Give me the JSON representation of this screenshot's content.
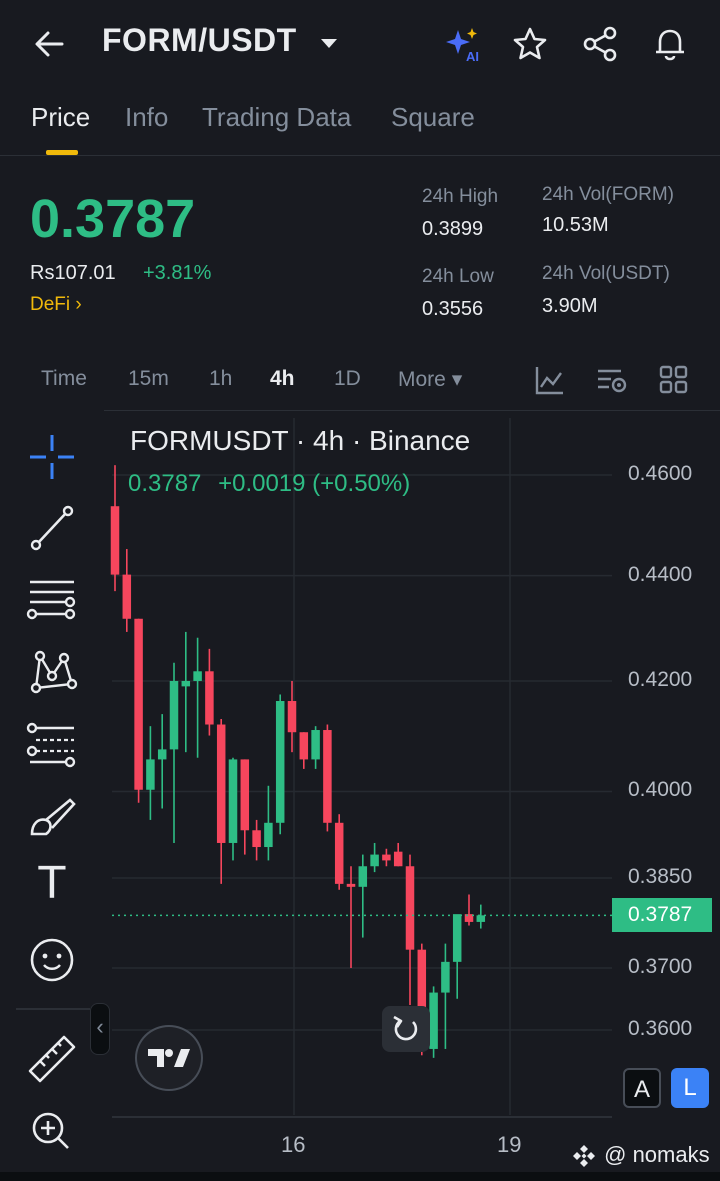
{
  "header": {
    "pair": "FORM/USDT",
    "icons": [
      "back-arrow-icon",
      "caret-down-icon",
      "ai-sparkle-icon",
      "star-icon",
      "share-icon",
      "bell-icon"
    ]
  },
  "tabs": [
    {
      "label": "Price",
      "active": true
    },
    {
      "label": "Info",
      "active": false
    },
    {
      "label": "Trading Data",
      "active": false
    },
    {
      "label": "Square",
      "active": false
    }
  ],
  "ticker": {
    "price": "0.3787",
    "fiat": "Rs107.01",
    "change": "+3.81%",
    "category": "DeFi",
    "category_chevron": "›",
    "high_label": "24h High",
    "high_value": "0.3899",
    "low_label": "24h Low",
    "low_value": "0.3556",
    "vol_base_label": "24h Vol(FORM)",
    "vol_base_value": "10.53M",
    "vol_quote_label": "24h Vol(USDT)",
    "vol_quote_value": "3.90M"
  },
  "intervals": {
    "items": [
      "Time",
      "15m",
      "1h",
      "4h",
      "1D"
    ],
    "active": "4h",
    "more_label": "More",
    "more_caret": "▾"
  },
  "colors": {
    "up": "#2ebd85",
    "down": "#f6465d",
    "accent": "#f0b90b",
    "background": "#181a20",
    "blue": "#3b82f6"
  },
  "chart": {
    "title": "FORMUSDT · 4h · Binance",
    "last": "0.3787",
    "delta": "+0.0019 (+0.50%)",
    "price_tag": "0.3787",
    "scale_a": "A",
    "scale_l": "L"
  },
  "chart_data": {
    "type": "candlestick",
    "symbol": "FORMUSDT",
    "interval": "4h",
    "exchange": "Binance",
    "y_scale": "log",
    "y_ticks": [
      "0.4600",
      "0.4400",
      "0.4200",
      "0.4000",
      "0.3850",
      "0.3700",
      "0.3600"
    ],
    "x_ticks": [
      "16",
      "19"
    ],
    "grid": true,
    "last_price": 0.3787,
    "candles": [
      {
        "o": 0.4537,
        "h": 0.462,
        "l": 0.437,
        "c": 0.4402
      },
      {
        "o": 0.4402,
        "h": 0.4452,
        "l": 0.4292,
        "c": 0.4317
      },
      {
        "o": 0.4317,
        "h": 0.4317,
        "l": 0.398,
        "c": 0.4003
      },
      {
        "o": 0.4003,
        "h": 0.4117,
        "l": 0.395,
        "c": 0.4057
      },
      {
        "o": 0.4057,
        "h": 0.4139,
        "l": 0.397,
        "c": 0.4075
      },
      {
        "o": 0.4075,
        "h": 0.4234,
        "l": 0.391,
        "c": 0.42
      },
      {
        "o": 0.419,
        "h": 0.4292,
        "l": 0.407,
        "c": 0.42
      },
      {
        "o": 0.42,
        "h": 0.4281,
        "l": 0.406,
        "c": 0.4218
      },
      {
        "o": 0.4218,
        "h": 0.426,
        "l": 0.41,
        "c": 0.412
      },
      {
        "o": 0.412,
        "h": 0.413,
        "l": 0.384,
        "c": 0.391
      },
      {
        "o": 0.391,
        "h": 0.406,
        "l": 0.388,
        "c": 0.4057
      },
      {
        "o": 0.4057,
        "h": 0.4057,
        "l": 0.389,
        "c": 0.3932
      },
      {
        "o": 0.3932,
        "h": 0.395,
        "l": 0.388,
        "c": 0.3903
      },
      {
        "o": 0.3903,
        "h": 0.401,
        "l": 0.388,
        "c": 0.3945
      },
      {
        "o": 0.3945,
        "h": 0.4175,
        "l": 0.3925,
        "c": 0.4163
      },
      {
        "o": 0.4163,
        "h": 0.42,
        "l": 0.407,
        "c": 0.4106
      },
      {
        "o": 0.4106,
        "h": 0.4106,
        "l": 0.404,
        "c": 0.4057
      },
      {
        "o": 0.4057,
        "h": 0.4117,
        "l": 0.404,
        "c": 0.411
      },
      {
        "o": 0.411,
        "h": 0.412,
        "l": 0.393,
        "c": 0.3945
      },
      {
        "o": 0.3945,
        "h": 0.396,
        "l": 0.383,
        "c": 0.384
      },
      {
        "o": 0.384,
        "h": 0.387,
        "l": 0.37,
        "c": 0.3835
      },
      {
        "o": 0.3835,
        "h": 0.389,
        "l": 0.375,
        "c": 0.387
      },
      {
        "o": 0.387,
        "h": 0.391,
        "l": 0.386,
        "c": 0.389
      },
      {
        "o": 0.389,
        "h": 0.39,
        "l": 0.387,
        "c": 0.388
      },
      {
        "o": 0.3895,
        "h": 0.391,
        "l": 0.387,
        "c": 0.387
      },
      {
        "o": 0.387,
        "h": 0.389,
        "l": 0.364,
        "c": 0.373
      },
      {
        "o": 0.373,
        "h": 0.374,
        "l": 0.356,
        "c": 0.363
      },
      {
        "o": 0.357,
        "h": 0.367,
        "l": 0.3556,
        "c": 0.366
      },
      {
        "o": 0.366,
        "h": 0.374,
        "l": 0.357,
        "c": 0.371
      },
      {
        "o": 0.371,
        "h": 0.375,
        "l": 0.365,
        "c": 0.3789
      },
      {
        "o": 0.3789,
        "h": 0.3822,
        "l": 0.377,
        "c": 0.3776
      },
      {
        "o": 0.3776,
        "h": 0.3805,
        "l": 0.3765,
        "c": 0.3787
      }
    ]
  },
  "toolbar": {
    "icons": [
      "crosshair-icon",
      "trend-line-icon",
      "horizontal-lines-icon",
      "pattern-icon",
      "fib-retracement-icon",
      "brush-icon",
      "text-icon",
      "emoji-icon",
      "ruler-icon",
      "zoom-in-icon"
    ],
    "text_glyph": "T",
    "collapse_glyph": "‹"
  },
  "footer": {
    "watermark": "@ nomaks"
  }
}
